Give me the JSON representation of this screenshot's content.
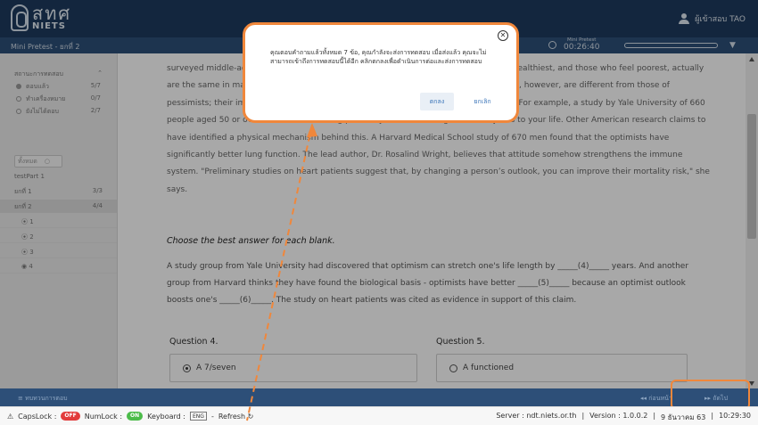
{
  "header": {
    "logo_thai": "สทศ",
    "logo_sub": "NIETS",
    "user_name": "ผู้เข้าสอบ TAO"
  },
  "subheader": {
    "exam_title": "Mini Pretest - ยกที่ 2",
    "timer_label": "Mini Pretest",
    "timer_value": "00:26:40"
  },
  "sidebar": {
    "status_head": "สถานะการทดสอบ",
    "statuses": [
      {
        "label": "ตอบแล้ว",
        "count": "5/7"
      },
      {
        "label": "ทำเครื่องหมาย",
        "count": "0/7"
      },
      {
        "label": "ยังไม่ได้ตอบ",
        "count": "2/7"
      }
    ],
    "toggle_label": "ทั้งหมด",
    "part_label": "testPart 1",
    "parts": [
      {
        "label": "ยกที่ 1",
        "count": "3/3"
      },
      {
        "label": "ยกที่ 2",
        "count": "4/4"
      }
    ],
    "sub_questions": [
      "1",
      "2",
      "3",
      "4"
    ]
  },
  "passage": "surveyed middle-aged men found that those who are optimistic about the future feel wealthiest, and those who feel poorest, actually are the same in many aspects. Researchers say these attitudes and behaviour patterns, however, are different from those of pessimists; their immune systems are also different - in general, they are more robust. For example, a study by Yale University of 660 people aged 50 or over, found that thinking positively adds an average of seven years to your life. Other American research claims to have identified a physical mechanism behind this. A Harvard Medical School study of 670 men found that the optimists have significantly better lung function. The lead author, Dr. Rosalind Wright, believes that attitude somehow strengthens the immune system. \"Preliminary studies on heart patients suggest that, by changing a person’s outlook, you can improve their mortality risk,\" she says.",
  "instruction": "Choose the best answer for each blank.",
  "cloze": "A study group from Yale University had discovered that optimism can stretch one's life length by _____(4)_____ years. And another group from Harvard thinks they have found the biological basis - optimists have better _____(5)_____ because an optimist outlook boosts one's _____(6)_____. The study on heart patients was cited as evidence in support of this claim.",
  "questions": [
    {
      "title": "Question 4.",
      "option": "A  7/seven"
    },
    {
      "title": "Question 5.",
      "option": "A  functioned"
    }
  ],
  "footer": {
    "left": "ทบทวนการตอบ",
    "prev": "ก่อนหน้า",
    "next": "ถัดไป"
  },
  "statusbar": {
    "capslock_label": "CapsLock :",
    "capslock_state": "OFF",
    "numlock_label": "NumLock :",
    "numlock_state": "ON",
    "keyboard_label": "Keyboard :",
    "keyboard_value": "ENG",
    "refresh_label": "Refresh",
    "server": "Server : ndt.niets.or.th",
    "version": "Version : 1.0.0.2",
    "date": "9 ธันวาคม 63",
    "time": "10:29:30"
  },
  "modal": {
    "message": "คุณตอบคำถามแล้วทั้งหมด 7 ข้อ, คุณกำลังจะส่งการทดสอบ เมื่อส่งแล้ว คุณจะไม่สามารถเข้าถึงการทดสอบนี้ได้อีก คลิกตกลงเพื่อดำเนินการต่อและส่งการทดสอบ",
    "ok_label": "ตกลง",
    "cancel_label": "ยกเลิก"
  },
  "colors": {
    "header": "#1e3a5f",
    "subheader": "#2d4f78",
    "callout": "#f0873b",
    "link_blue": "#3a74b8"
  }
}
